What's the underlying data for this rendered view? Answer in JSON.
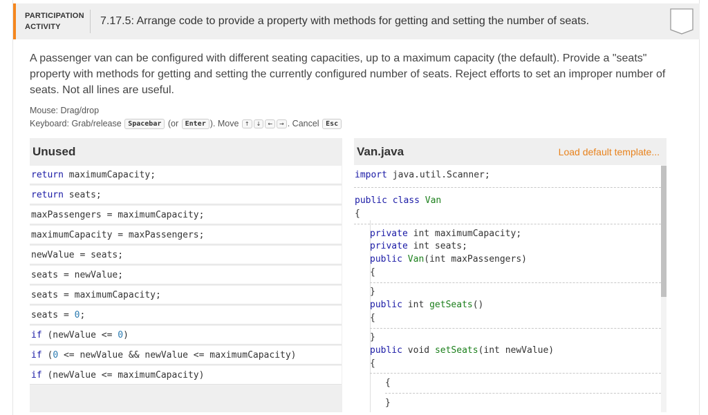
{
  "header": {
    "participation_line1": "PARTICIPATION",
    "participation_line2": "ACTIVITY",
    "activity_title": "7.17.5: Arrange code to provide a property with methods for getting and setting the number of seats.",
    "completion_icon": "chevron-badge-icon"
  },
  "description": "A passenger van can be configured with different seating capacities, up to a maximum capacity (the default). Provide a \"seats\" property with methods for getting and setting the currently configured number of seats. Reject efforts to set an improper number of seats. Not all lines are useful.",
  "instructions": {
    "mouse": "Mouse: Drag/drop",
    "keyboard_prefix": "Keyboard: Grab/release",
    "key_spacebar": "Spacebar",
    "or_open": "(or",
    "key_enter": "Enter",
    "move_text": "). Move",
    "key_up": "↑",
    "key_down": "↓",
    "key_left": "←",
    "key_right": "→",
    "cancel_text": ". Cancel",
    "key_esc": "Esc"
  },
  "unused": {
    "title": "Unused",
    "blocks": [
      {
        "kw": "return",
        "rest": " maximumCapacity;"
      },
      {
        "kw": "return",
        "rest": " seats;"
      },
      {
        "kw": "",
        "rest": "maxPassengers = maximumCapacity;"
      },
      {
        "kw": "",
        "rest": "maximumCapacity = maxPassengers;"
      },
      {
        "kw": "",
        "rest": "newValue = seats;"
      },
      {
        "kw": "",
        "rest": "seats = newValue;"
      },
      {
        "kw": "",
        "rest": "seats = maximumCapacity;"
      },
      {
        "kw": "",
        "rest": "seats = ",
        "num": "0",
        "tail": ";"
      },
      {
        "kw": "if",
        "rest": " (newValue <= ",
        "num": "0",
        "tail": ")"
      },
      {
        "kw": "if",
        "rest": " (",
        "num": "0",
        "tail": " <= newValue && newValue <= maximumCapacity)"
      },
      {
        "kw": "if",
        "rest": " (newValue <= maximumCapacity)"
      }
    ]
  },
  "van": {
    "title": "Van.java",
    "load_link": "Load default template...",
    "import_kw": "import",
    "import_rest": " java.util.Scanner;",
    "class_kw1": "public",
    "class_kw2": "class",
    "class_name": "Van",
    "open_brace": "{",
    "close_brace": "}",
    "field1_kw": "private",
    "field1_rest": " int maximumCapacity;",
    "field2_kw": "private",
    "field2_rest": " int seats;",
    "ctor_kw": "public",
    "ctor_name": "Van",
    "ctor_rest": "(int maxPassengers)",
    "get_kw": "public",
    "get_type": " int ",
    "get_name": "getSeats",
    "get_rest": "()",
    "set_kw": "public",
    "set_type": " void ",
    "set_name": "setSeats",
    "set_rest": "(int newValue)"
  }
}
